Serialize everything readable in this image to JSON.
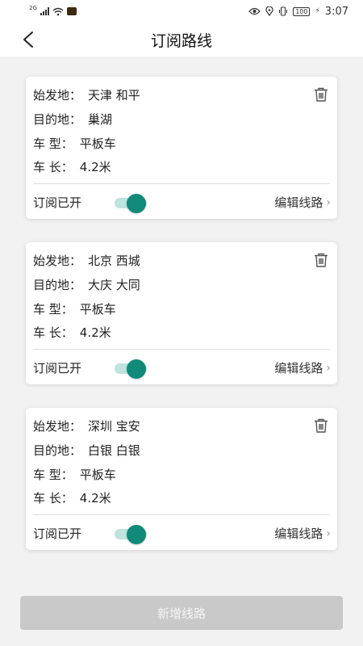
{
  "status_bar": {
    "network": "2G",
    "battery": "100",
    "time": "3:07"
  },
  "header": {
    "title": "订阅路线"
  },
  "labels": {
    "origin": "始发地：",
    "destination": "目的地：",
    "truck_type": "车 型：",
    "truck_length": "车 长：",
    "subscription": "订阅已开",
    "edit": "编辑线路"
  },
  "routes": [
    {
      "origin": "天津 和平",
      "destination": "巢湖",
      "truck_type": "平板车",
      "truck_length": "4.2米",
      "subscribed": true
    },
    {
      "origin": "北京 西城",
      "destination": "大庆 大同",
      "truck_type": "平板车",
      "truck_length": "4.2米",
      "subscribed": true
    },
    {
      "origin": "深圳 宝安",
      "destination": "白银 白银",
      "truck_type": "平板车",
      "truck_length": "4.2米",
      "subscribed": true
    }
  ],
  "add_button": "新增线路",
  "colors": {
    "toggle_on": "#128a7a",
    "toggle_track": "#bfe3dd",
    "disabled_button": "#c9c9c9"
  }
}
